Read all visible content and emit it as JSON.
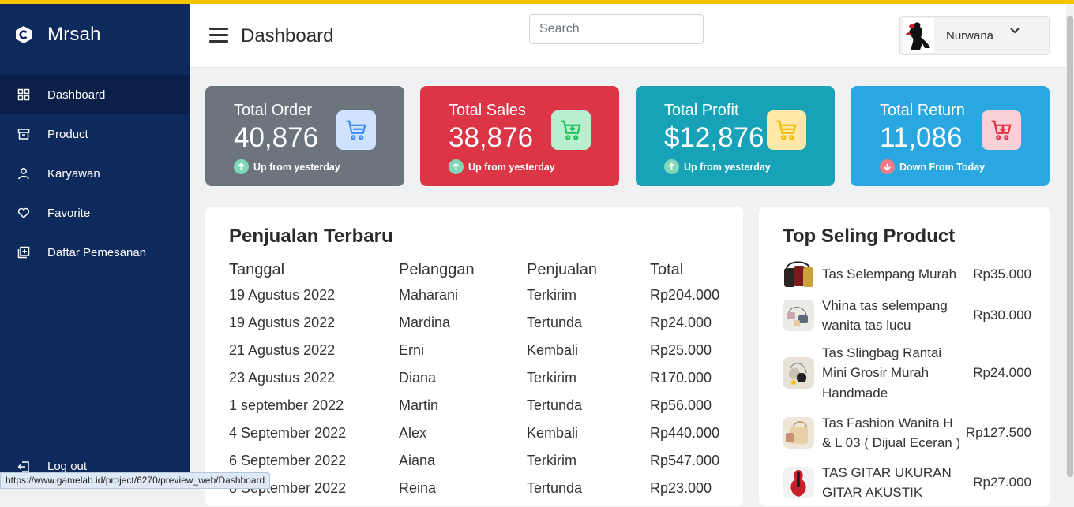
{
  "brand": {
    "name": "Mrsah"
  },
  "sidebar": {
    "items": [
      {
        "label": "Dashboard",
        "icon": "grid-icon",
        "active": true
      },
      {
        "label": "Product",
        "icon": "archive-icon",
        "active": false
      },
      {
        "label": "Karyawan",
        "icon": "user-icon",
        "active": false
      },
      {
        "label": "Favorite",
        "icon": "heart-icon",
        "active": false
      },
      {
        "label": "Daftar Pemesanan",
        "icon": "add-square-icon",
        "active": false
      }
    ],
    "logout_label": "Log out"
  },
  "header": {
    "title": "Dashboard",
    "search_placeholder": "Search",
    "user_name": "Nurwana"
  },
  "cards": [
    {
      "label": "Total Order",
      "value": "40,876",
      "trend": "Up from yesterday",
      "direction": "up",
      "bg": "#6c757d",
      "icon_bg": "#cfe2ff",
      "icon_color": "#3d8bfd"
    },
    {
      "label": "Total Sales",
      "value": "38,876",
      "trend": "Up from yesterday",
      "direction": "up",
      "bg": "#dc3545",
      "icon_bg": "#b8f0cf",
      "icon_color": "#20c05a"
    },
    {
      "label": "Total Profit",
      "value": "$12,876",
      "trend": "Up from yesterday",
      "direction": "up",
      "bg": "#17a2b8",
      "icon_bg": "#ffe8a8",
      "icon_color": "#f0b90b"
    },
    {
      "label": "Total Return",
      "value": "11,086",
      "trend": "Down From Today",
      "direction": "down",
      "bg": "#2aa7e0",
      "icon_bg": "#f8d0d6",
      "icon_color": "#e3334a"
    }
  ],
  "sales": {
    "title": "Penjualan Terbaru",
    "columns": [
      "Tanggal",
      "Pelanggan",
      "Penjualan",
      "Total"
    ],
    "rows": [
      [
        "19 Agustus 2022",
        "Maharani",
        "Terkirim",
        "Rp204.000"
      ],
      [
        "19 Agustus 2022",
        "Mardina",
        "Tertunda",
        "Rp24.000"
      ],
      [
        "21 Agustus 2022",
        "Erni",
        "Kembali",
        "Rp25.000"
      ],
      [
        "23 Agustus 2022",
        "Diana",
        "Terkirim",
        "R170.000"
      ],
      [
        "1 september 2022",
        "Martin",
        "Tertunda",
        "Rp56.000"
      ],
      [
        "4 September 2022",
        "Alex",
        "Kembali",
        "Rp440.000"
      ],
      [
        "6 September 2022",
        "Aiana",
        "Terkirim",
        "Rp547.000"
      ],
      [
        "8 September 2022",
        "Reina",
        "Tertunda",
        "Rp23.000"
      ]
    ]
  },
  "top_products": {
    "title": "Top Seling Product",
    "items": [
      {
        "name": "Tas Selempang Murah",
        "price": "Rp35.000"
      },
      {
        "name": "Vhina tas selempang wanita tas lucu",
        "price": "Rp30.000"
      },
      {
        "name": "Tas Slingbag Rantai Mini Grosir Murah Handmade",
        "price": "Rp24.000"
      },
      {
        "name": "Tas Fashion Wanita H & L 03 ( Dijual Eceran )",
        "price": "Rp127.500"
      },
      {
        "name": "TAS GITAR UKURAN GITAR AKUSTIK",
        "price": "Rp27.000"
      }
    ]
  },
  "status_bar": {
    "url": "https://www.gamelab.id/project/6270/preview_web/Dashboard"
  }
}
